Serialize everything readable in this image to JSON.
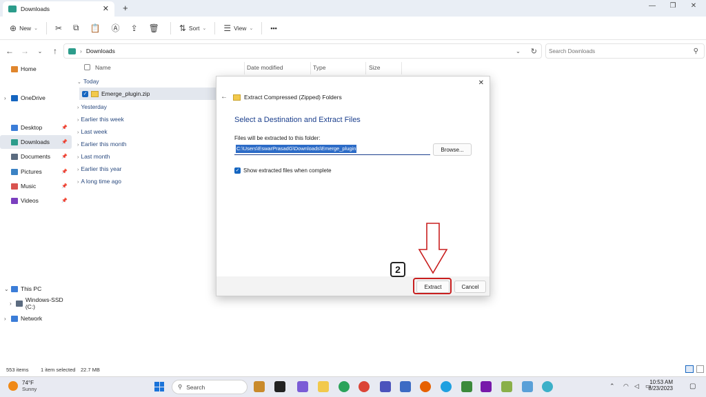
{
  "window": {
    "tab_title": "Downloads",
    "tab_close": "✕",
    "new_tab": "+",
    "minimize": "—",
    "restore": "❐",
    "close": "✕"
  },
  "toolbar": {
    "new_label": "New",
    "sort_label": "Sort",
    "view_label": "View",
    "more": "•••"
  },
  "address": {
    "path": "Downloads",
    "search_placeholder": "Search Downloads"
  },
  "sidebar": {
    "items": [
      {
        "label": "Home",
        "color": "#e0862d"
      },
      {
        "label": "OneDrive",
        "color": "#1565c0"
      },
      {
        "label": "Desktop",
        "color": "#3b7dd8"
      },
      {
        "label": "Downloads",
        "color": "#2c9c8b"
      },
      {
        "label": "Documents",
        "color": "#5b6b7f"
      },
      {
        "label": "Pictures",
        "color": "#3b82c4"
      },
      {
        "label": "Music",
        "color": "#d9534f"
      },
      {
        "label": "Videos",
        "color": "#7b3fbf"
      },
      {
        "label": "This PC",
        "color": "#3b7dd8"
      },
      {
        "label": "Windows-SSD (C:)",
        "color": "#5b6b7f"
      },
      {
        "label": "Network",
        "color": "#3b7dd8"
      }
    ]
  },
  "files": {
    "columns": [
      "Name",
      "Date modified",
      "Type",
      "Size"
    ],
    "groups": [
      "Today",
      "Yesterday",
      "Earlier this week",
      "Last week",
      "Earlier this month",
      "Last month",
      "Earlier this year",
      "A long time ago"
    ],
    "selected_file": "Emerge_plugin.zip"
  },
  "dialog": {
    "header": "Extract Compressed (Zipped) Folders",
    "title": "Select a Destination and Extract Files",
    "path_label": "Files will be extracted to this folder:",
    "path_value": "C:\\Users\\EswarPrasadG\\Downloads\\Emerge_plugin",
    "browse_label": "Browse...",
    "checkbox_label": "Show extracted files when complete",
    "extract_label": "Extract",
    "cancel_label": "Cancel"
  },
  "annotation": {
    "step": "2",
    "color": "#c81e1e"
  },
  "status": {
    "items": "553 items",
    "selection": "1 item selected",
    "size": "22.7 MB"
  },
  "taskbar": {
    "temp": "74°F",
    "condition": "Sunny",
    "search": "Search",
    "time": "10:53 AM",
    "date": "8/23/2023"
  }
}
